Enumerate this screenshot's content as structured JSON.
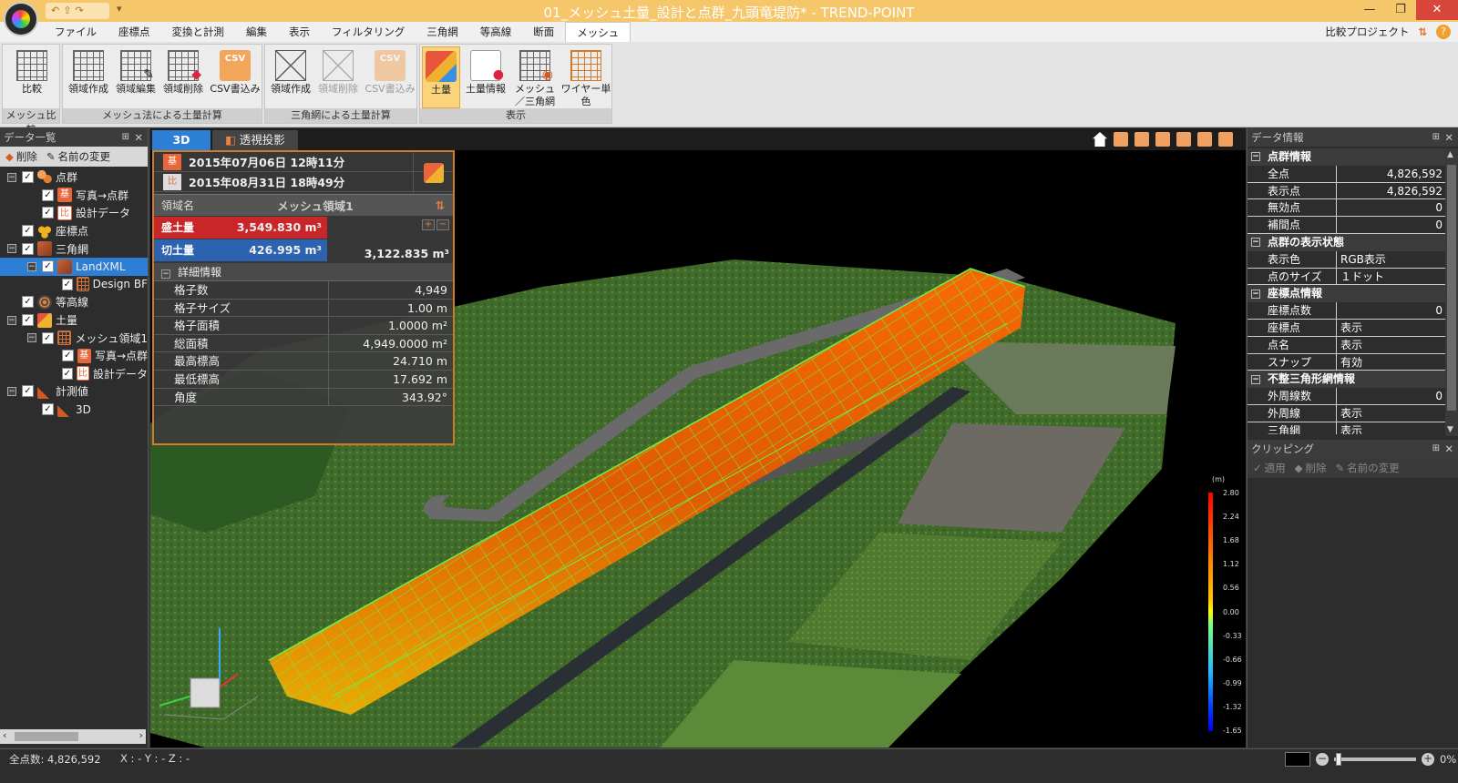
{
  "titlebar": {
    "title": "01_メッシュ土量_設計と点群_九頭竜堤防* - TREND-POINT",
    "minimize": "—",
    "maximize": "❐",
    "close": "✕"
  },
  "menubar": {
    "items": [
      "ファイル",
      "座標点",
      "変換と計測",
      "編集",
      "表示",
      "フィルタリング",
      "三角網",
      "等高線",
      "断面",
      "メッシュ"
    ],
    "active": "メッシュ",
    "right_label": "比較プロジェクト",
    "help": "?"
  },
  "ribbon": {
    "groups": [
      {
        "label": "メッシュ比較",
        "buttons": [
          {
            "label": "比較"
          }
        ]
      },
      {
        "label": "メッシュ法による土量計算",
        "buttons": [
          {
            "label": "領域作成"
          },
          {
            "label": "領域編集"
          },
          {
            "label": "領域削除"
          },
          {
            "label": "CSV書込み"
          }
        ]
      },
      {
        "label": "三角網による土量計算",
        "buttons": [
          {
            "label": "領域作成"
          },
          {
            "label": "領域削除"
          },
          {
            "label": "CSV書込み"
          }
        ]
      },
      {
        "label": "表示",
        "buttons": [
          {
            "label": "土量"
          },
          {
            "label": "土量情報"
          },
          {
            "label": "メッシュ／三角網"
          },
          {
            "label": "ワイヤー単色"
          }
        ]
      }
    ]
  },
  "left_panel": {
    "title": "データ一覧",
    "pin": "⊞",
    "close": "✕",
    "toolbar": {
      "delete": "削除",
      "rename": "名前の変更"
    },
    "tree": [
      {
        "label": "点群",
        "icon": "point-cloud-icon"
      },
      {
        "label": "写真→点群",
        "icon": "base-badge-icon",
        "badge": "基"
      },
      {
        "label": "設計データ",
        "icon": "compare-badge-icon",
        "badge": "比"
      },
      {
        "label": "座標点",
        "icon": "coordinate-points-icon"
      },
      {
        "label": "三角網",
        "icon": "triangle-net-icon"
      },
      {
        "label": "LandXML",
        "icon": "landxml-icon"
      },
      {
        "label": "Design BF",
        "icon": "design-mesh-icon"
      },
      {
        "label": "等高線",
        "icon": "contour-icon"
      },
      {
        "label": "土量",
        "icon": "earthwork-icon"
      },
      {
        "label": "メッシュ領域1",
        "icon": "mesh-region-icon"
      },
      {
        "label": "写真→点群",
        "icon": "base-badge-icon",
        "badge": "基"
      },
      {
        "label": "設計データ",
        "icon": "compare-badge-icon",
        "badge": "比"
      },
      {
        "label": "計測値",
        "icon": "measurement-icon"
      },
      {
        "label": "3D",
        "icon": "measurement-3d-icon"
      }
    ]
  },
  "viewport": {
    "tab_3d": "3D",
    "tab_perspective": "透視投影"
  },
  "volume_info": {
    "base_badge": "基",
    "compare_badge": "比",
    "base_date": "2015年07月06日 12時11分",
    "compare_date": "2015年08月31日 18時49分",
    "region_key": "領域名",
    "region_value": "メッシュ領域1",
    "fill_key": "盛土量",
    "fill_value": "3,549.830 m³",
    "cut_key": "切土量",
    "cut_value": "426.995 m³",
    "net_value": "3,122.835 m³",
    "detail_header": "詳細情報",
    "details": [
      {
        "key": "格子数",
        "value": "4,949"
      },
      {
        "key": "格子サイズ",
        "value": "1.00 m"
      },
      {
        "key": "格子面積",
        "value": "1.0000 m²"
      },
      {
        "key": "総面積",
        "value": "4,949.0000 m²"
      },
      {
        "key": "最高標高",
        "value": "24.710 m"
      },
      {
        "key": "最低標高",
        "value": "17.692 m"
      },
      {
        "key": "角度",
        "value": "343.92°"
      }
    ]
  },
  "legend": {
    "unit": "(m)",
    "ticks": [
      "2.80",
      "2.24",
      "1.68",
      "1.12",
      "0.56",
      "0.00",
      "-0.33",
      "-0.66",
      "-0.99",
      "-1.32",
      "-1.65"
    ]
  },
  "data_info": {
    "title": "データ情報",
    "groups": [
      {
        "label": "点群情報",
        "rows": [
          {
            "key": "全点",
            "value": "4,826,592",
            "num": true
          },
          {
            "key": "表示点",
            "value": "4,826,592",
            "num": true
          },
          {
            "key": "無効点",
            "value": "0",
            "num": true
          },
          {
            "key": "補間点",
            "value": "0",
            "num": true
          }
        ]
      },
      {
        "label": "点群の表示状態",
        "rows": [
          {
            "key": "表示色",
            "value": "RGB表示"
          },
          {
            "key": "点のサイズ",
            "value": "１ドット"
          }
        ]
      },
      {
        "label": "座標点情報",
        "rows": [
          {
            "key": "座標点数",
            "value": "0",
            "num": true
          },
          {
            "key": "座標点",
            "value": "表示"
          },
          {
            "key": "点名",
            "value": "表示"
          },
          {
            "key": "スナップ",
            "value": "有効"
          }
        ]
      },
      {
        "label": "不整三角形網情報",
        "rows": [
          {
            "key": "外周線数",
            "value": "0",
            "num": true
          },
          {
            "key": "外周線",
            "value": "表示"
          },
          {
            "key": "三角網",
            "value": "表示"
          }
        ]
      }
    ]
  },
  "clipping": {
    "title": "クリッピング",
    "apply": "適用",
    "delete": "削除",
    "rename": "名前の変更"
  },
  "statusbar": {
    "total_points": "全点数: 4,826,592",
    "xyz": "X : -   Y : -   Z : -",
    "zoom": "0%"
  }
}
